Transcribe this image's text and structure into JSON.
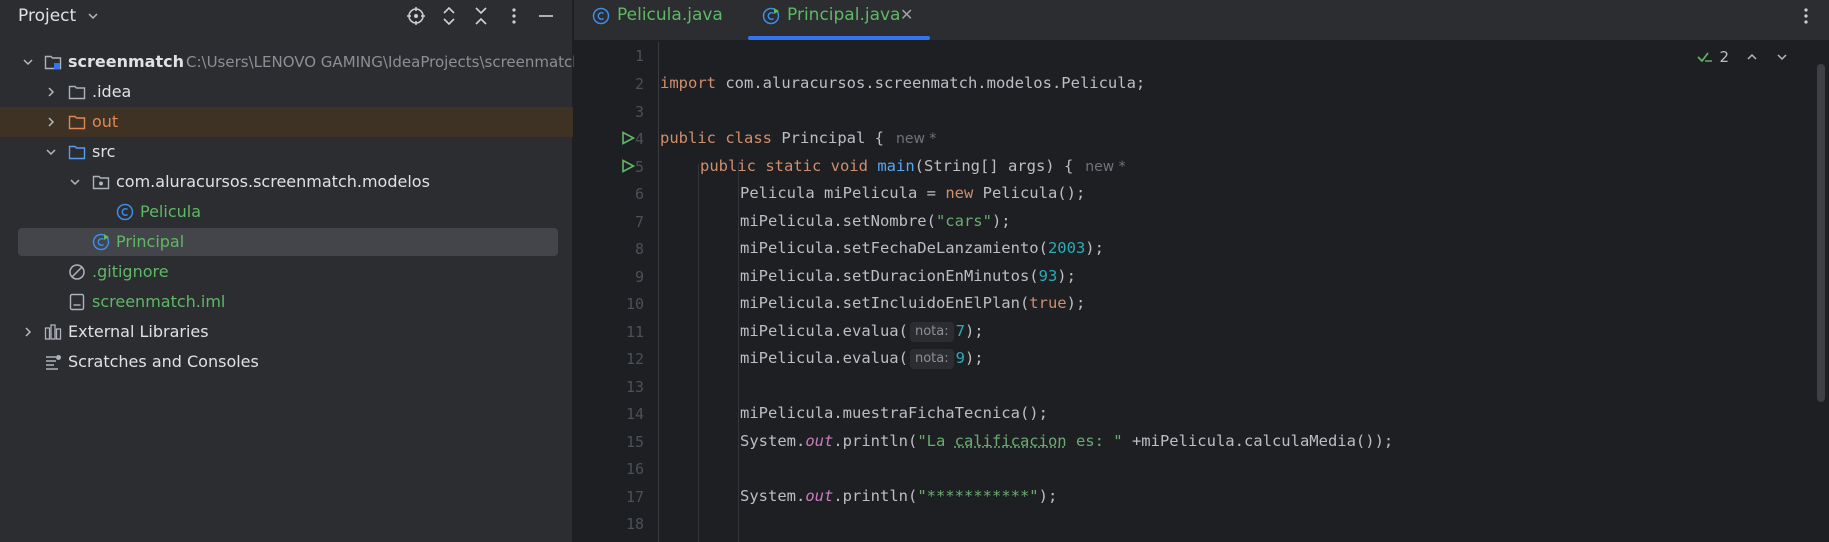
{
  "project_panel": {
    "title": "Project",
    "tree": [
      {
        "name": "tree-row-screenmatch",
        "label": "screenmatch",
        "path": "C:\\Users\\LENOVO GAMING\\IdeaProjects\\screenmatch"
      },
      {
        "name": "tree-row-idea",
        "label": ".idea"
      },
      {
        "name": "tree-row-out",
        "label": "out"
      },
      {
        "name": "tree-row-src",
        "label": "src"
      },
      {
        "name": "tree-row-package",
        "label": "com.aluracursos.screenmatch.modelos"
      },
      {
        "name": "tree-row-pelicula",
        "label": "Pelicula"
      },
      {
        "name": "tree-row-principal",
        "label": "Principal"
      },
      {
        "name": "tree-row-gitignore",
        "label": ".gitignore"
      },
      {
        "name": "tree-row-iml",
        "label": "screenmatch.iml"
      },
      {
        "name": "tree-row-external-libraries",
        "label": "External Libraries"
      },
      {
        "name": "tree-row-scratches",
        "label": "Scratches and Consoles"
      }
    ]
  },
  "tabs": [
    {
      "label": "Pelicula.java",
      "active": false
    },
    {
      "label": "Principal.java",
      "active": true
    }
  ],
  "editor": {
    "inspection_count": "2",
    "line_numbers": [
      "1",
      "2",
      "3",
      "4",
      "5",
      "6",
      "7",
      "8",
      "9",
      "10",
      "11",
      "12",
      "13",
      "14",
      "15",
      "16",
      "17",
      "18"
    ],
    "code": {
      "l2_import": "import",
      "l2_rest": " com.aluracursos.screenmatch.modelos.Pelicula;",
      "l4_public": "public",
      "l4_class": "class",
      "l4_rest": " Principal {",
      "l4_lens": "new *",
      "l5_mods": "public static void",
      "l5_main": "main",
      "l5_rest": "(String[] args) {",
      "l5_lens": "new *",
      "l6_a": "Pelicula miPelicula = ",
      "l6_new": "new",
      "l6_b": " Pelicula();",
      "l7_a": "miPelicula.setNombre(",
      "l7_str": "\"cars\"",
      "l7_b": ");",
      "l8_a": "miPelicula.setFechaDeLanzamiento(",
      "l8_num": "2003",
      "l8_b": ");",
      "l9_a": "miPelicula.setDuracionEnMinutos(",
      "l9_num": "93",
      "l9_b": ");",
      "l10_a": "miPelicula.setIncluidoEnElPlan(",
      "l10_kw": "true",
      "l10_b": ");",
      "l11_a": "miPelicula.evalua(",
      "l11_hint": "nota:",
      "l11_num": "7",
      "l11_b": ");",
      "l12_a": "miPelicula.evalua(",
      "l12_hint": "nota:",
      "l12_num": "9",
      "l12_b": ");",
      "l14": "miPelicula.muestraFichaTecnica();",
      "l15_a": "System.",
      "l15_out": "out",
      "l15_b": ".println(",
      "l15_s1": "\"La ",
      "l15_typo": "calificacion",
      "l15_s2": " es: \"",
      "l15_c": " +miPelicula.calculaMedia());",
      "l17_a": "System.",
      "l17_out": "out",
      "l17_b": ".println(",
      "l17_str": "\"***********\"",
      "l17_c": ");"
    }
  },
  "colors": {
    "accent": "#3574f0",
    "keyword": "#cf8e6d",
    "string": "#6aab73",
    "number": "#2aacb8",
    "method": "#56a8f5",
    "static_field": "#c77dbb",
    "class_icon": "#3d8ce6",
    "run_icon": "#5fb865"
  },
  "icons": [
    "chevron-down-icon",
    "locate-icon",
    "expand-all-icon",
    "collapse-all-icon",
    "more-vertical-icon",
    "minimize-icon",
    "folder-icon",
    "module-icon",
    "package-icon",
    "class-icon",
    "main-class-icon",
    "gitignore-icon",
    "iml-file-icon",
    "library-icon",
    "scratches-icon",
    "run-icon",
    "check-icon",
    "close-icon"
  ]
}
